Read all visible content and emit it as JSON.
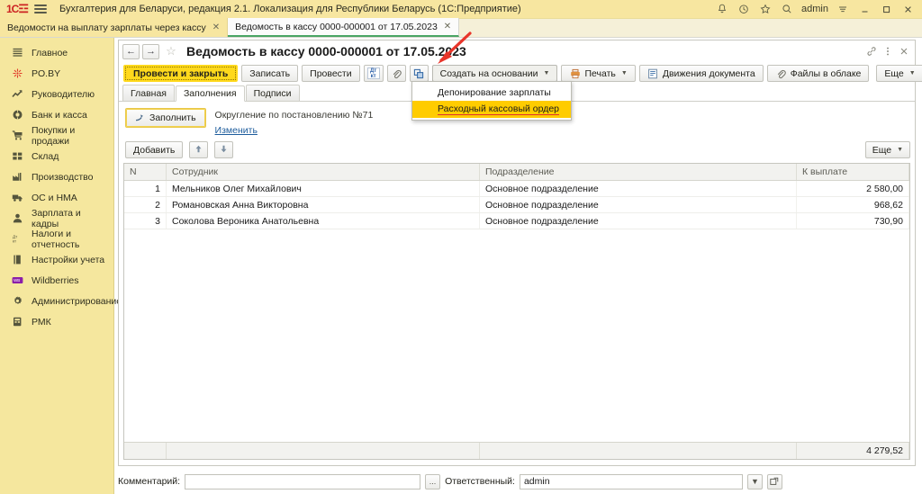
{
  "titlebar": {
    "logo": "1C",
    "app_title": "Бухгалтерия для Беларуси, редакция 2.1. Локализация для Республики Беларусь   (1С:Предприятие)",
    "user": "admin",
    "icons": [
      "bell-icon",
      "history-icon",
      "star-icon",
      "search-icon",
      "menu-icon"
    ],
    "window_buttons": [
      "minimize-button",
      "maximize-button",
      "close-button"
    ],
    "bg_color": "#f7e6a0"
  },
  "tabs": [
    {
      "label": "Ведомости на выплату зарплаты через кассу",
      "active": false
    },
    {
      "label": "Ведомость в кассу 0000-000001 от 17.05.2023",
      "active": true
    }
  ],
  "sidebar": {
    "items": [
      {
        "label": "Главное",
        "icon": "list-icon"
      },
      {
        "label": "PO.BY",
        "icon": "burst-icon"
      },
      {
        "label": "Руководителю",
        "icon": "trend-up-icon"
      },
      {
        "label": "Банк и касса",
        "icon": "coin-icon"
      },
      {
        "label": "Покупки и продажи",
        "icon": "cart-icon"
      },
      {
        "label": "Склад",
        "icon": "boxes-icon"
      },
      {
        "label": "Производство",
        "icon": "factory-icon"
      },
      {
        "label": "ОС и НМА",
        "icon": "truck-icon"
      },
      {
        "label": "Зарплата и кадры",
        "icon": "person-icon"
      },
      {
        "label": "Налоги и отчетность",
        "icon": "dtkt-icon"
      },
      {
        "label": "Настройки учета",
        "icon": "book-icon"
      },
      {
        "label": "Wildberries",
        "icon": "wildberries-icon"
      },
      {
        "label": "Администрирование",
        "icon": "gear-icon"
      },
      {
        "label": "РМК",
        "icon": "register-icon"
      }
    ],
    "bg_color": "#f5e79e"
  },
  "document": {
    "title": "Ведомость в кассу 0000-000001 от 17.05.2023",
    "nav_back": "←",
    "nav_forward": "→",
    "favorite_icon": "star-icon",
    "header_icons": [
      "link-icon",
      "more-options-icon",
      "close-icon"
    ],
    "toolbar": {
      "post_and_close": "Провести и закрыть",
      "write": "Записать",
      "post": "Провести",
      "dtkt_icon": "dtkt-icon",
      "attach_icon": "paperclip-icon",
      "report_icon": "report-icon",
      "create_based_on": "Создать на основании",
      "print": "Печать",
      "doc_movements": "Движения документа",
      "cloud_files": "Файлы в облаке",
      "more": "Еще"
    },
    "dropdown": {
      "open": true,
      "items": [
        {
          "label": "Депонирование зарплаты",
          "highlighted": false
        },
        {
          "label": "Расходный кассовый ордер",
          "highlighted": true
        }
      ],
      "highlight_color": "#ffcc00",
      "underline_color": "#e03030"
    },
    "form_tabs": [
      {
        "label": "Главная",
        "active": false
      },
      {
        "label": "Заполнения",
        "active": true
      },
      {
        "label": "Подписи",
        "active": false
      }
    ],
    "fill_section": {
      "fill_button": "Заполнить",
      "note": "Округление по постановлению №71",
      "change_link": "Изменить"
    },
    "grid_toolbar": {
      "add": "Добавить",
      "move_up_icon": "arrow-up-icon",
      "move_down_icon": "arrow-down-icon",
      "more": "Еще"
    },
    "footer": {
      "comment_label": "Комментарий:",
      "comment_value": "",
      "comment_placeholder": "",
      "comment_select_button": "...",
      "responsible_label": "Ответственный:",
      "responsible_value": "admin",
      "responsible_dropdown_icon": "chevron-down-icon",
      "responsible_open_icon": "open-link-icon"
    }
  },
  "table": {
    "columns": [
      "N",
      "Сотрудник",
      "Подразделение",
      "К выплате"
    ],
    "rows": [
      {
        "n": "1",
        "employee": "Мельников Олег Михайлович",
        "department": "Основное подразделение",
        "pay": "2 580,00"
      },
      {
        "n": "2",
        "employee": "Романовская Анна Викторовна",
        "department": "Основное подразделение",
        "pay": "968,62"
      },
      {
        "n": "3",
        "employee": "Соколова Вероника Анатольевна",
        "department": "Основное подразделение",
        "pay": "730,90"
      }
    ],
    "total": "4 279,52"
  },
  "annotation": {
    "type": "arrow",
    "color": "#e8352a",
    "points_to": "create-based-on-button"
  }
}
